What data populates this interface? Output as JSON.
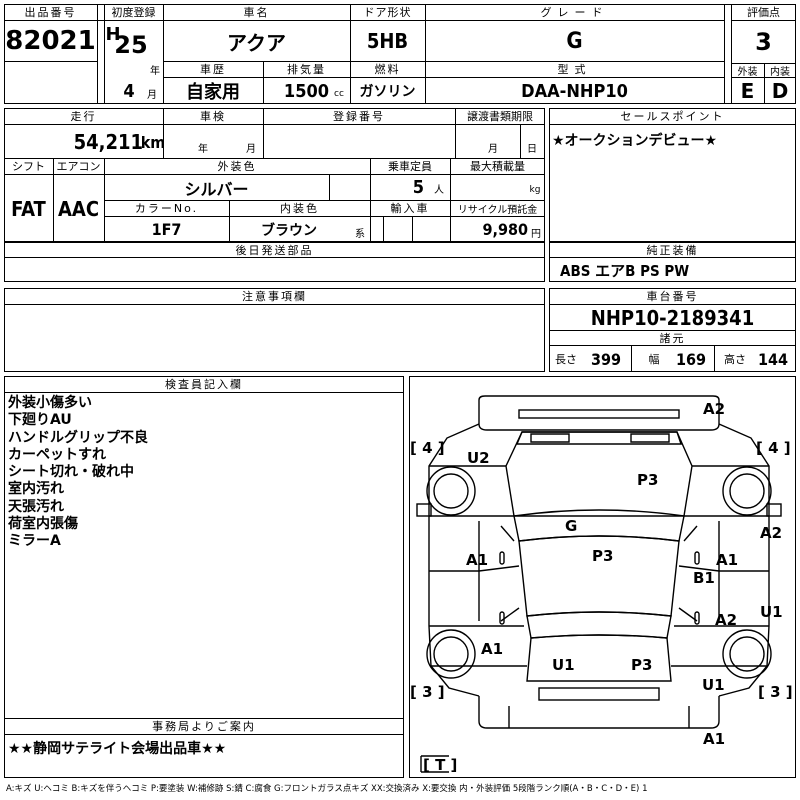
{
  "labels": {
    "lot_no": "出品番号",
    "first_reg": "初度登録",
    "car_name": "車名",
    "doors": "ドア形状",
    "grade": "グレード",
    "score": "評価点",
    "history": "車歴",
    "displacement": "排気量",
    "fuel": "燃料",
    "model": "型式",
    "exterior": "外装",
    "interior": "内装",
    "mileage": "走行",
    "inspection": "車検",
    "reg_no": "登録番号",
    "transfer": "譲渡書類期限",
    "sales_point": "セールスポイント",
    "shift": "シフト",
    "aircon": "エアコン",
    "ext_color": "外装色",
    "capacity": "乗車定員",
    "max_load": "最大積載量",
    "color_no": "カラーNo.",
    "int_color": "内装色",
    "import": "輸入車",
    "recycle": "リサイクル預託金",
    "later_parts": "後日発送部品",
    "genuine": "純正装備",
    "caution": "注意事項欄",
    "chassis": "車台番号",
    "specs": "諸元",
    "inspector": "検査員記入欄",
    "office": "事務局よりご案内"
  },
  "units": {
    "year": "年",
    "month": "月",
    "cc": "cc",
    "km": "km",
    "person": "人",
    "kg": "kg",
    "kei": "系",
    "yen": "円",
    "year2": "年",
    "month2": "月",
    "day": "日",
    "length": "長さ",
    "width": "幅",
    "height": "高さ"
  },
  "values": {
    "lot_no": "82021",
    "era": "H",
    "year": "25",
    "month": "4",
    "car_name": "アクア",
    "doors": "5HB",
    "grade": "G",
    "score": "3",
    "history": "自家用",
    "displacement": "1500",
    "fuel": "ガソリン",
    "model": "DAA-NHP10",
    "exterior": "E",
    "interior": "D",
    "mileage": "54,211",
    "sales_point": "★オークションデビュー★",
    "shift": "FAT",
    "aircon": "AAC",
    "ext_color": "シルバー",
    "capacity": "5",
    "color_no": "1F7",
    "int_color": "ブラウン",
    "recycle": "9,980",
    "genuine": "ABS エアB PS PW",
    "chassis": "NHP10-2189341",
    "length": "399",
    "width": "169",
    "height": "144"
  },
  "inspector_notes": [
    "外装小傷多い",
    "下廻りAU",
    "ハンドルグリップ不良",
    "カーペットすれ",
    "シート切れ・破れ中",
    "室内汚れ",
    "天張汚れ",
    "荷室内張傷",
    "ミラーA"
  ],
  "office_note": "★★静岡サテライト会場出品車★★",
  "diagram_marks": {
    "a2_top": "A2",
    "tire_fl": "[ 4 ]",
    "tire_fr": "[ 4 ]",
    "u2": "U2",
    "p3_hood": "P3",
    "g": "G",
    "a2_right": "A2",
    "a1_left": "A1",
    "p3_roof": "P3",
    "a1_right": "A1",
    "b1": "B1",
    "u1_right": "U1",
    "a2_rear_right": "A2",
    "a1_rear_left": "A1",
    "u1_rear": "U1",
    "p3_trunk": "P3",
    "u1_rear_right": "U1",
    "tire_rl": "[ 3 ]",
    "tire_rr": "[ 3 ]",
    "a1_bottom": "A1",
    "t_mark": "[ T ]"
  },
  "legend": "A:キズ U:ヘコミ B:キズを伴うヘコミ P:要塗装 W:補修跡 S:錆 C:腐食 G:フロントガラス点キズ XX:交換済み X:要交換 内・外装評価 5段階ランク順(A・B・C・D・E) 1"
}
